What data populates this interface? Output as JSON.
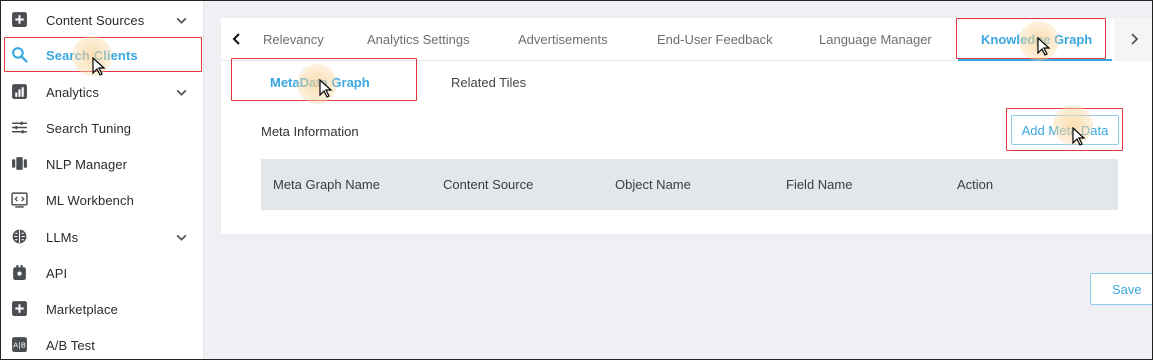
{
  "sidebar": {
    "items": [
      {
        "label": "Content Sources",
        "icon": "plus-square-icon"
      },
      {
        "label": "Search Clients",
        "icon": "search-icon"
      },
      {
        "label": "Analytics",
        "icon": "bar-chart-icon"
      },
      {
        "label": "Search Tuning",
        "icon": "sliders-icon"
      },
      {
        "label": "NLP Manager",
        "icon": "nlp-icon"
      },
      {
        "label": "ML Workbench",
        "icon": "code-window-icon"
      },
      {
        "label": "LLMs",
        "icon": "brain-icon"
      },
      {
        "label": "API",
        "icon": "api-icon"
      },
      {
        "label": "Marketplace",
        "icon": "plus-square-icon"
      },
      {
        "label": "A/B Test",
        "icon": "ab-test-icon"
      }
    ],
    "active": "Search Clients"
  },
  "tabs": {
    "items": [
      {
        "label": "Relevancy"
      },
      {
        "label": "Analytics Settings"
      },
      {
        "label": "Advertisements"
      },
      {
        "label": "End-User Feedback"
      },
      {
        "label": "Language Manager"
      },
      {
        "label": "Knowledge Graph"
      }
    ],
    "active": "Knowledge Graph"
  },
  "subtabs": {
    "items": [
      {
        "label": "MetaData Graph"
      },
      {
        "label": "Related Tiles"
      }
    ],
    "active": "MetaData Graph"
  },
  "meta": {
    "title": "Meta Information",
    "add_button": "Add Meta Data",
    "columns": [
      "Meta Graph Name",
      "Content Source",
      "Object Name",
      "Field Name",
      "Action"
    ]
  },
  "footer": {
    "save_button": "Save"
  },
  "colors": {
    "accent": "#3aa7e0",
    "highlight": "#e0393f",
    "table_header_bg": "#e3e6ea"
  }
}
